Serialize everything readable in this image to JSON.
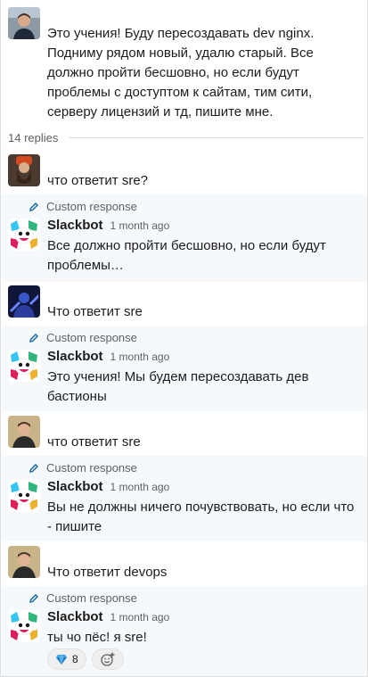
{
  "parent": {
    "text": "Это учения! Буду пересоздавать dev nginx. Подниму рядом новый, удалю старый.  Все должно пройти бесшовно, но если будут проблемы с доступтом к сайтам, тим сити, серверу лицензий и тд, пишите мне."
  },
  "replies_label": "14 replies",
  "custom_response_label": "Custom response",
  "slackbot_name": "Slackbot",
  "threads": [
    {
      "user_text": "что ответит sre?",
      "bot_time": "1 month ago",
      "bot_text": "Все должно пройти бесшовно, но если будут проблемы…"
    },
    {
      "user_text": "Что ответит sre",
      "bot_time": "1 month ago",
      "bot_text": "Это учения! Мы будем пересоздавать дев бастионы"
    },
    {
      "user_text": "что ответит sre",
      "bot_time": "1 month ago",
      "bot_text": "Вы не должны ничего почувствовать, но если что - пишите"
    },
    {
      "user_text": "Что ответит devops",
      "bot_time": "1 month ago",
      "bot_text": "ты чо пёс! я sre!"
    }
  ],
  "reactions": [
    {
      "emoji": "gem-icon",
      "count": "8"
    },
    {
      "emoji": "add-reaction-icon"
    }
  ],
  "colors": {
    "bot_background": "#f5f9fb",
    "link_blue": "#1264a3",
    "muted_text": "#616061"
  }
}
